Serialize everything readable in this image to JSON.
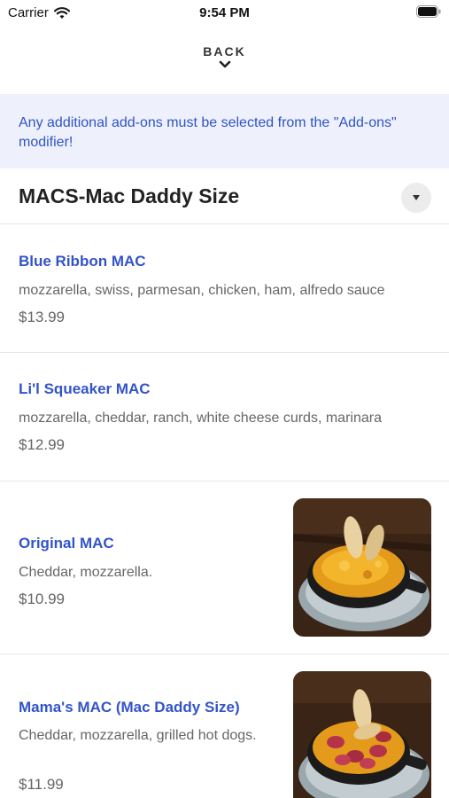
{
  "status_bar": {
    "carrier": "Carrier",
    "time": "9:54 PM"
  },
  "back": {
    "label": "BACK"
  },
  "notice": {
    "text": "Any additional add-ons must be selected from the \"Add-ons\" modifier!"
  },
  "section": {
    "title": "MACS-Mac Daddy Size"
  },
  "items": [
    {
      "name": "Blue Ribbon MAC",
      "description": "mozzarella, swiss, parmesan, chicken, ham, alfredo sauce",
      "price": "$13.99"
    },
    {
      "name": "Li'l Squeaker MAC",
      "description": "mozzarella, cheddar, ranch, white cheese curds, marinara",
      "price": "$12.99"
    },
    {
      "name": "Original MAC",
      "description": "Cheddar, mozzarella.",
      "price": "$10.99"
    },
    {
      "name": "Mama's MAC (Mac Daddy Size)",
      "description": "Cheddar, mozzarella, grilled hot dogs.",
      "price": "$11.99"
    }
  ],
  "colors": {
    "accent": "#3354c8",
    "notice_bg": "#eef1fb",
    "notice_text": "#2f53c7"
  },
  "icons": {
    "wifi": "wifi-icon",
    "battery": "battery-icon",
    "back": "chevron-down-icon",
    "dropdown": "caret-down-icon"
  }
}
